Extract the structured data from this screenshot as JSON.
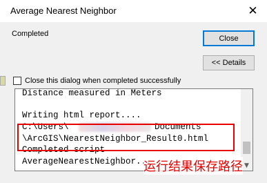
{
  "window": {
    "title": "Average Nearest Neighbor",
    "close_glyph": "✕"
  },
  "status": {
    "text": "Completed"
  },
  "buttons": {
    "close_label": "Close",
    "details_label": "<< Details"
  },
  "checkbox": {
    "label": "Close this dialog when completed successfully",
    "checked": false
  },
  "log": {
    "lines": [
      "Distance measured in Meters",
      "",
      "Writing html report....",
      "C:\\Users\\",
      "\\ArcGIS\\NearestNeighbor_Result0.html",
      "Completed script",
      "AverageNearestNeighbor..."
    ],
    "line3_suffix": "Documents"
  },
  "annotation": {
    "text": "运行结果保存路径",
    "color": "#e60000"
  },
  "icons": {
    "scroll_down": "chevron-down-icon"
  }
}
